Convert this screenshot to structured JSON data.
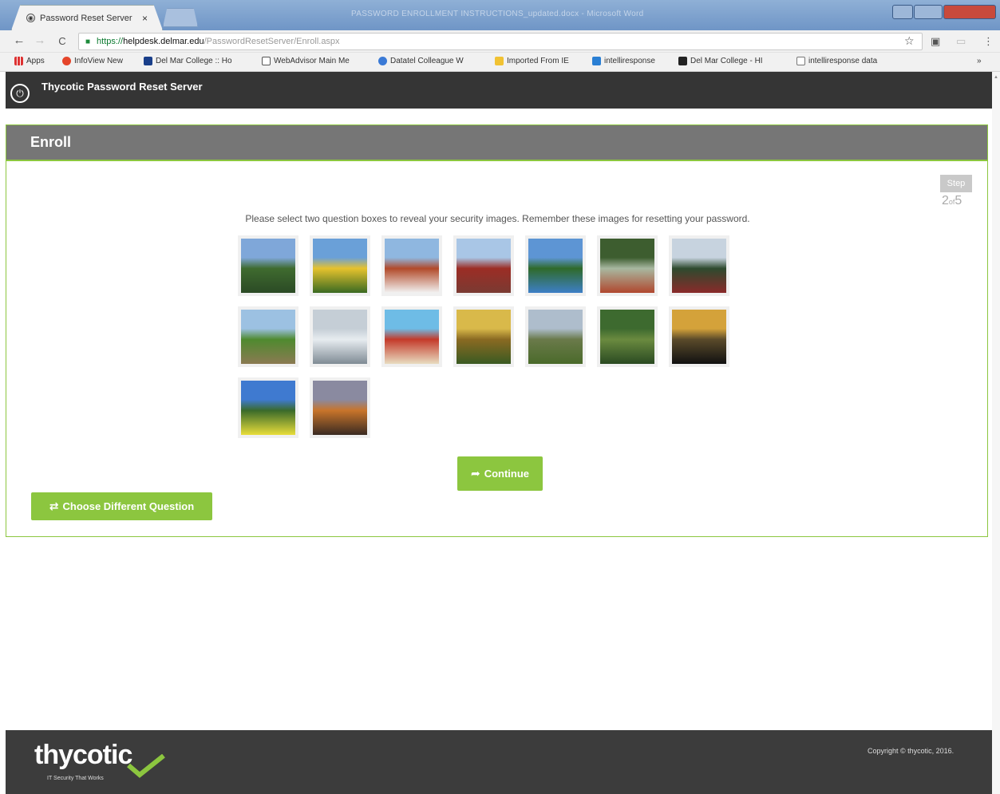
{
  "browser": {
    "tab_title": "Password Reset Server",
    "tab_close": "×",
    "window_title": "PASSWORD ENROLLMENT INSTRUCTIONS_updated.docx - Microsoft Word",
    "nav_back": "←",
    "nav_forward": "→",
    "nav_reload": "C",
    "url_scheme": "https://",
    "url_host": "helpdesk.delmar.edu",
    "url_path": "/PasswordResetServer/Enroll.aspx",
    "bookmarks": [
      "Apps",
      "InfoView New",
      "Del Mar College :: Ho",
      "WebAdvisor Main Me",
      "Datatel Colleague W",
      "Imported From IE",
      "intelliresponse",
      "Del Mar College - HI",
      "intelliresponse data"
    ],
    "bookmarks_more": "»"
  },
  "header": {
    "app_title": "Thycotic Password Reset Server"
  },
  "panel": {
    "title": "Enroll",
    "step_label": "Step",
    "step_current": "2",
    "step_of": "of",
    "step_total": "5",
    "instruction": "Please select two question boxes to reveal your security images. Remember these images for resetting your password."
  },
  "images": [
    {
      "name": "river-valley",
      "colors": [
        "#7fa7d9",
        "#3f6b2f",
        "#2b4a25"
      ]
    },
    {
      "name": "yellow-house",
      "colors": [
        "#6aa0d8",
        "#e6c22d",
        "#3a6a22"
      ]
    },
    {
      "name": "winter-town",
      "colors": [
        "#8fb7e0",
        "#b24a2a",
        "#f2f2f2"
      ]
    },
    {
      "name": "cathedral",
      "colors": [
        "#a9c6e6",
        "#9c2d25",
        "#7a3a32"
      ]
    },
    {
      "name": "lake-reflection",
      "colors": [
        "#5d95d4",
        "#2f6a2a",
        "#3d7fc7"
      ]
    },
    {
      "name": "forest-path",
      "colors": [
        "#3d5d2f",
        "#a8b8a0",
        "#b0472e"
      ]
    },
    {
      "name": "snowy-cabin",
      "colors": [
        "#c7d3df",
        "#2e4a2e",
        "#8a2a2a"
      ]
    },
    {
      "name": "dirt-road",
      "colors": [
        "#9cc1e2",
        "#4f8a2f",
        "#8b7a52"
      ]
    },
    {
      "name": "glacier",
      "colors": [
        "#c5ced6",
        "#e7ecf0",
        "#7f8b94"
      ]
    },
    {
      "name": "lifeguard-tower",
      "colors": [
        "#6ebce6",
        "#c43a2a",
        "#e8dcc0"
      ]
    },
    {
      "name": "wheat-field",
      "colors": [
        "#d9b94a",
        "#8a6a22",
        "#3a5a22"
      ]
    },
    {
      "name": "misty-mountains",
      "colors": [
        "#aebdcc",
        "#6a7a4a",
        "#4a6a2a"
      ]
    },
    {
      "name": "green-canyon",
      "colors": [
        "#3d6a2f",
        "#6a8a3f",
        "#2a4a22"
      ]
    },
    {
      "name": "sunset-trees",
      "colors": [
        "#d4a23a",
        "#5a4a2a",
        "#111111"
      ]
    },
    {
      "name": "flower-meadow",
      "colors": [
        "#3f7ad0",
        "#3a6a2a",
        "#e8dd3a"
      ]
    },
    {
      "name": "mountain-dusk",
      "colors": [
        "#8a8aa0",
        "#c8742a",
        "#3a2a22"
      ]
    }
  ],
  "buttons": {
    "continue": "Continue",
    "continue_icon": "share-arrow-icon",
    "choose_different": "Choose Different Question",
    "choose_icon": "exchange-icon"
  },
  "footer": {
    "brand": "thycotic",
    "tagline": "IT Security That Works",
    "copyright": "Copyright © thycotic, 2016."
  },
  "colors": {
    "accent": "#8cc63f",
    "header_bg": "#353535",
    "panel_head_bg": "#767676",
    "footer_bg": "#3c3c3c"
  }
}
